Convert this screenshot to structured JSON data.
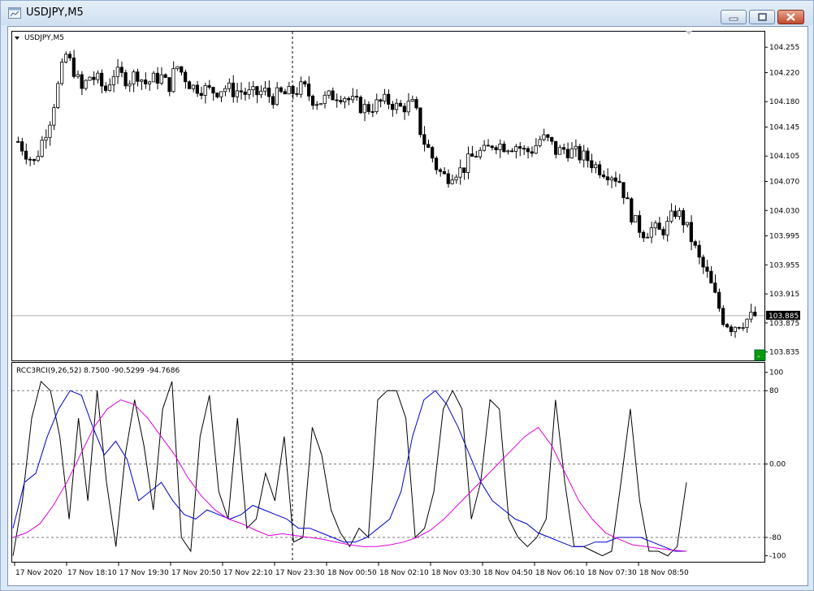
{
  "window": {
    "title": "USDJPY,M5",
    "colors": {
      "titlebar": "#d6e4f3",
      "close": "#c8553a"
    }
  },
  "main_chart": {
    "symbol_label": "USDJPY,M5",
    "price_ticks": [
      "104.255",
      "104.220",
      "104.180",
      "104.145",
      "104.105",
      "104.070",
      "104.030",
      "103.995",
      "103.955",
      "103.915",
      "103.875",
      "103.835"
    ],
    "current_price": "103.885",
    "current_price_value": 103.885,
    "price_range": [
      103.83,
      104.272
    ]
  },
  "indicator": {
    "label": "RCC3RCI(9,26,52) 8.7500 -90.5299 -94.7686",
    "level_ticks": [
      "100",
      "80",
      "0.00",
      "-80",
      "-100"
    ],
    "levels": [
      80,
      0,
      -80
    ],
    "range": [
      -103,
      105
    ],
    "colors": {
      "short": "#000000",
      "mid": "#0000cc",
      "long": "#dd00dd"
    }
  },
  "time_axis": {
    "labels": [
      "17 Nov 2020",
      "17 Nov 18:10",
      "17 Nov 19:30",
      "17 Nov 20:50",
      "17 Nov 22:10",
      "17 Nov 23:30",
      "18 Nov 00:50",
      "18 Nov 02:10",
      "18 Nov 03:30",
      "18 Nov 04:50",
      "18 Nov 06:10",
      "18 Nov 07:30",
      "18 Nov 08:50"
    ]
  },
  "chart_data": [
    {
      "type": "candlestick",
      "title": "USDJPY,M5",
      "ylim": [
        103.83,
        104.272
      ],
      "close_path": [
        [
          0,
          104.125
        ],
        [
          2,
          104.095
        ],
        [
          4,
          104.155
        ],
        [
          5,
          104.2
        ],
        [
          6,
          104.245
        ],
        [
          7,
          104.225
        ],
        [
          8,
          104.195
        ],
        [
          9,
          104.215
        ],
        [
          10,
          104.21
        ],
        [
          11,
          104.195
        ],
        [
          12,
          104.22
        ],
        [
          13,
          104.215
        ],
        [
          14,
          104.21
        ],
        [
          15,
          104.22
        ],
        [
          16,
          104.205
        ],
        [
          17,
          104.21
        ],
        [
          18,
          104.215
        ],
        [
          19,
          104.2
        ],
        [
          20,
          104.23
        ],
        [
          21,
          104.215
        ],
        [
          22,
          104.2
        ],
        [
          23,
          104.2
        ],
        [
          24,
          104.195
        ],
        [
          25,
          104.195
        ],
        [
          26,
          104.2
        ],
        [
          27,
          104.195
        ],
        [
          28,
          104.195
        ],
        [
          29,
          104.19
        ],
        [
          30,
          104.19
        ],
        [
          31,
          104.195
        ],
        [
          32,
          104.185
        ],
        [
          33,
          104.19
        ],
        [
          34,
          104.19
        ],
        [
          35,
          104.195
        ],
        [
          36,
          104.2
        ],
        [
          37,
          104.185
        ],
        [
          38,
          104.18
        ],
        [
          39,
          104.185
        ],
        [
          40,
          104.19
        ],
        [
          41,
          104.19
        ],
        [
          42,
          104.18
        ],
        [
          43,
          104.175
        ],
        [
          44,
          104.17
        ],
        [
          45,
          104.175
        ],
        [
          46,
          104.18
        ],
        [
          47,
          104.18
        ],
        [
          48,
          104.17
        ],
        [
          49,
          104.175
        ],
        [
          50,
          104.175
        ],
        [
          51,
          104.13
        ],
        [
          52,
          104.11
        ],
        [
          53,
          104.085
        ],
        [
          54,
          104.075
        ],
        [
          55,
          104.085
        ],
        [
          56,
          104.085
        ],
        [
          57,
          104.1
        ],
        [
          58,
          104.11
        ],
        [
          59,
          104.11
        ],
        [
          60,
          104.125
        ],
        [
          61,
          104.12
        ],
        [
          62,
          104.12
        ],
        [
          63,
          104.12
        ],
        [
          64,
          104.11
        ],
        [
          65,
          104.115
        ],
        [
          66,
          104.13
        ],
        [
          67,
          104.125
        ],
        [
          68,
          104.11
        ],
        [
          69,
          104.115
        ],
        [
          70,
          104.11
        ],
        [
          71,
          104.105
        ],
        [
          72,
          104.1
        ],
        [
          73,
          104.09
        ],
        [
          74,
          104.085
        ],
        [
          75,
          104.08
        ],
        [
          76,
          104.07
        ],
        [
          77,
          104.035
        ],
        [
          78,
          104.01
        ],
        [
          79,
          104.0
        ],
        [
          80,
          104.005
        ],
        [
          81,
          104.0
        ],
        [
          82,
          104.01
        ],
        [
          83,
          104.03
        ],
        [
          84,
          104.015
        ],
        [
          85,
          103.99
        ],
        [
          86,
          103.96
        ],
        [
          87,
          103.94
        ],
        [
          88,
          103.91
        ],
        [
          89,
          103.88
        ],
        [
          90,
          103.87
        ],
        [
          91,
          103.875
        ],
        [
          92,
          103.88
        ],
        [
          93,
          103.885
        ]
      ]
    },
    {
      "type": "line",
      "title": "RCC3RCI(9,26,52)",
      "ylim": [
        -100,
        100
      ],
      "series": [
        {
          "name": "",
          "values": [
            -100,
            -40,
            50,
            90,
            80,
            30,
            -60,
            50,
            -40,
            80,
            -20,
            -90,
            10,
            70,
            20,
            -50,
            60,
            90,
            -80,
            -95,
            30,
            75,
            -30,
            -60,
            50,
            -70,
            -60,
            -10,
            -40,
            30,
            -85,
            -80,
            40,
            10,
            -50,
            -75,
            -90,
            -70,
            -80,
            70,
            80,
            80,
            50,
            -80,
            -70,
            -30,
            60,
            80,
            60,
            -60,
            -20,
            70,
            60,
            -60,
            -80,
            -90,
            -80,
            -60,
            70,
            -20,
            -90,
            -90,
            -95,
            -100,
            -95,
            -20,
            60,
            -40,
            -95,
            -95,
            -100,
            -90,
            -20
          ]
        },
        {
          "name": "",
          "values": [
            -70,
            -20,
            -10,
            30,
            60,
            80,
            75,
            40,
            10,
            25,
            5,
            -40,
            -30,
            -20,
            -40,
            -55,
            -60,
            -50,
            -55,
            -60,
            -55,
            -45,
            -50,
            -55,
            -60,
            -70,
            -70,
            -75,
            -80,
            -85,
            -85,
            -80,
            -70,
            -60,
            -30,
            30,
            70,
            80,
            65,
            40,
            10,
            -20,
            -40,
            -50,
            -60,
            -65,
            -75,
            -80,
            -85,
            -90,
            -90,
            -85,
            -85,
            -80,
            -80,
            -80,
            -85,
            -90,
            -95,
            -95
          ]
        },
        {
          "name": "",
          "values": [
            -80,
            -75,
            -65,
            -45,
            -20,
            10,
            40,
            60,
            70,
            65,
            50,
            30,
            10,
            -15,
            -35,
            -50,
            -60,
            -65,
            -72,
            -78,
            -76,
            -78,
            -80,
            -82,
            -85,
            -88,
            -90,
            -90,
            -88,
            -85,
            -80,
            -72,
            -60,
            -45,
            -30,
            -15,
            0,
            15,
            30,
            40,
            20,
            -10,
            -40,
            -60,
            -75,
            -82,
            -88,
            -90,
            -92,
            -94,
            -95
          ]
        }
      ]
    }
  ]
}
